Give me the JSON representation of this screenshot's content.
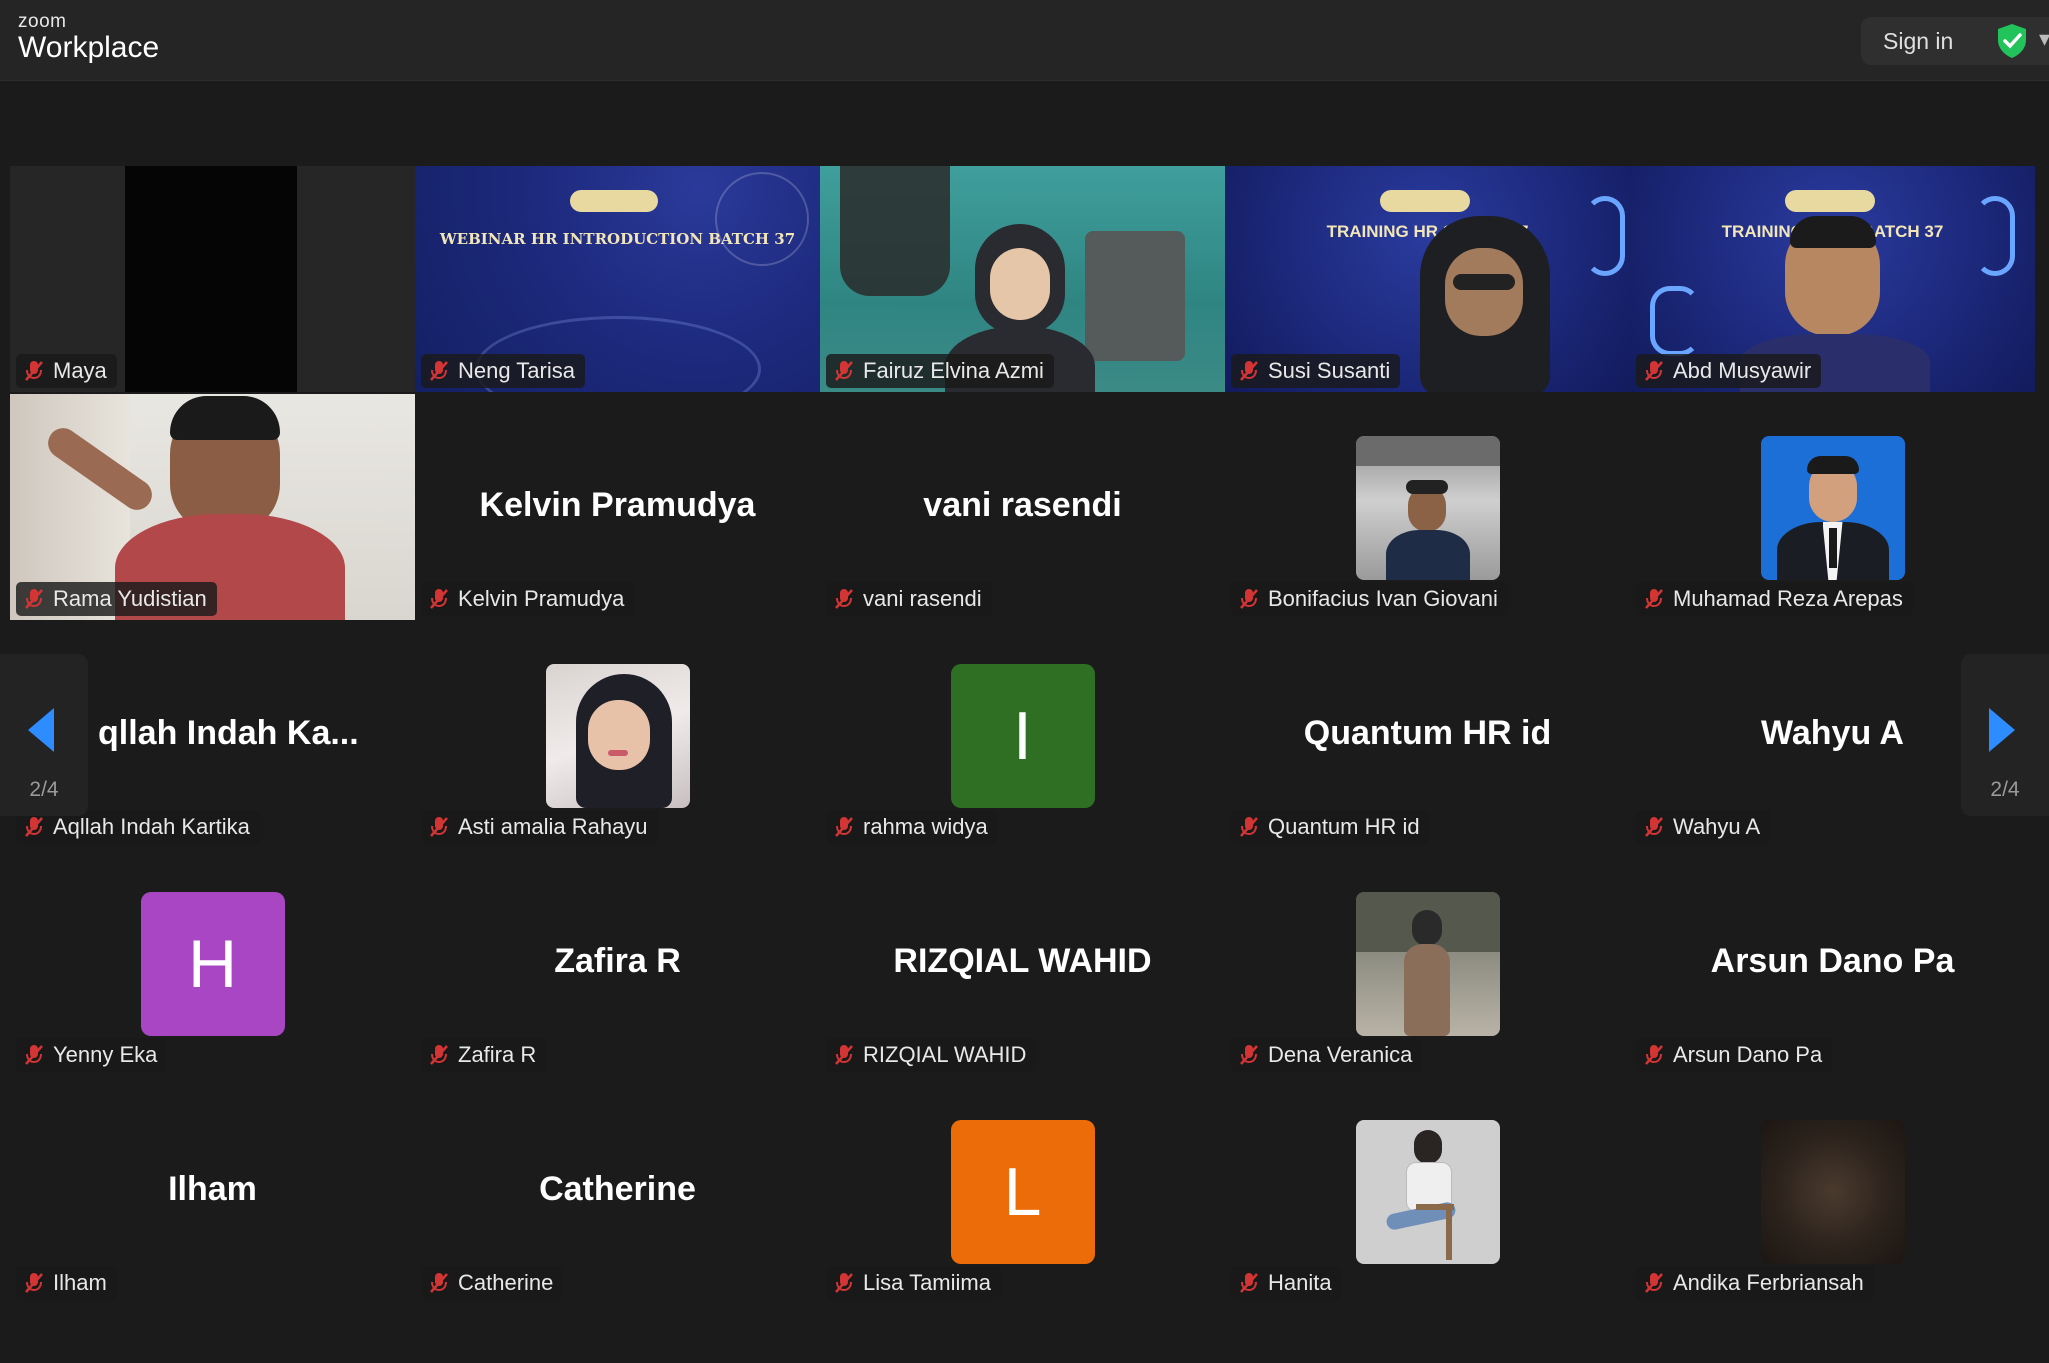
{
  "app": {
    "brand_small": "zoom",
    "brand_big": "Workplace",
    "sign_in": "Sign in"
  },
  "pager": {
    "page_indicator": "2/4"
  },
  "colors": {
    "accent": "#2d8cff",
    "muted_icon": "#d33535",
    "shield": "#21c35a"
  },
  "participants": [
    {
      "name": "Maya",
      "display": ""
    },
    {
      "name": "Neng Tarisa",
      "display": "",
      "slide_title": "WEBINAR HR INTRODUCTION BATCH 37"
    },
    {
      "name": "Fairuz Elvina Azmi",
      "display": ""
    },
    {
      "name": "Susi Susanti",
      "display": "",
      "slide_title": "TRAINING HR STAF     37"
    },
    {
      "name": "Abd Musyawir",
      "display": "",
      "slide_title": "TRAINING HR      BATCH 37"
    },
    {
      "name": "Rama Yudistian",
      "display": ""
    },
    {
      "name": "Kelvin Pramudya",
      "display": "Kelvin Pramudya"
    },
    {
      "name": "vani rasendi",
      "display": "vani rasendi"
    },
    {
      "name": "Bonifacius Ivan Giovani",
      "display": ""
    },
    {
      "name": "Muhamad Reza Arepas",
      "display": ""
    },
    {
      "name": "Aqllah Indah Kartika",
      "display": "qllah  Indah  Ka..."
    },
    {
      "name": "Asti amalia Rahayu",
      "display": ""
    },
    {
      "name": "rahma widya",
      "display": "",
      "initial": "I"
    },
    {
      "name": "Quantum HR id",
      "display": "Quantum HR id"
    },
    {
      "name": "Wahyu A",
      "display": "Wahyu A"
    },
    {
      "name": "Yenny Eka",
      "display": "",
      "initial": "H"
    },
    {
      "name": "Zafira R",
      "display": "Zafira R"
    },
    {
      "name": "RIZQIAL WAHID",
      "display": "RIZQIAL WAHID"
    },
    {
      "name": "Dena Veranica",
      "display": ""
    },
    {
      "name": "Arsun Dano Pa",
      "display": "Arsun Dano Pa"
    },
    {
      "name": "Ilham",
      "display": "Ilham"
    },
    {
      "name": "Catherine",
      "display": "Catherine"
    },
    {
      "name": "Lisa Tamiima",
      "display": "",
      "initial": "L"
    },
    {
      "name": "Hanita",
      "display": ""
    },
    {
      "name": "Andika Ferbriansah",
      "display": ""
    }
  ]
}
